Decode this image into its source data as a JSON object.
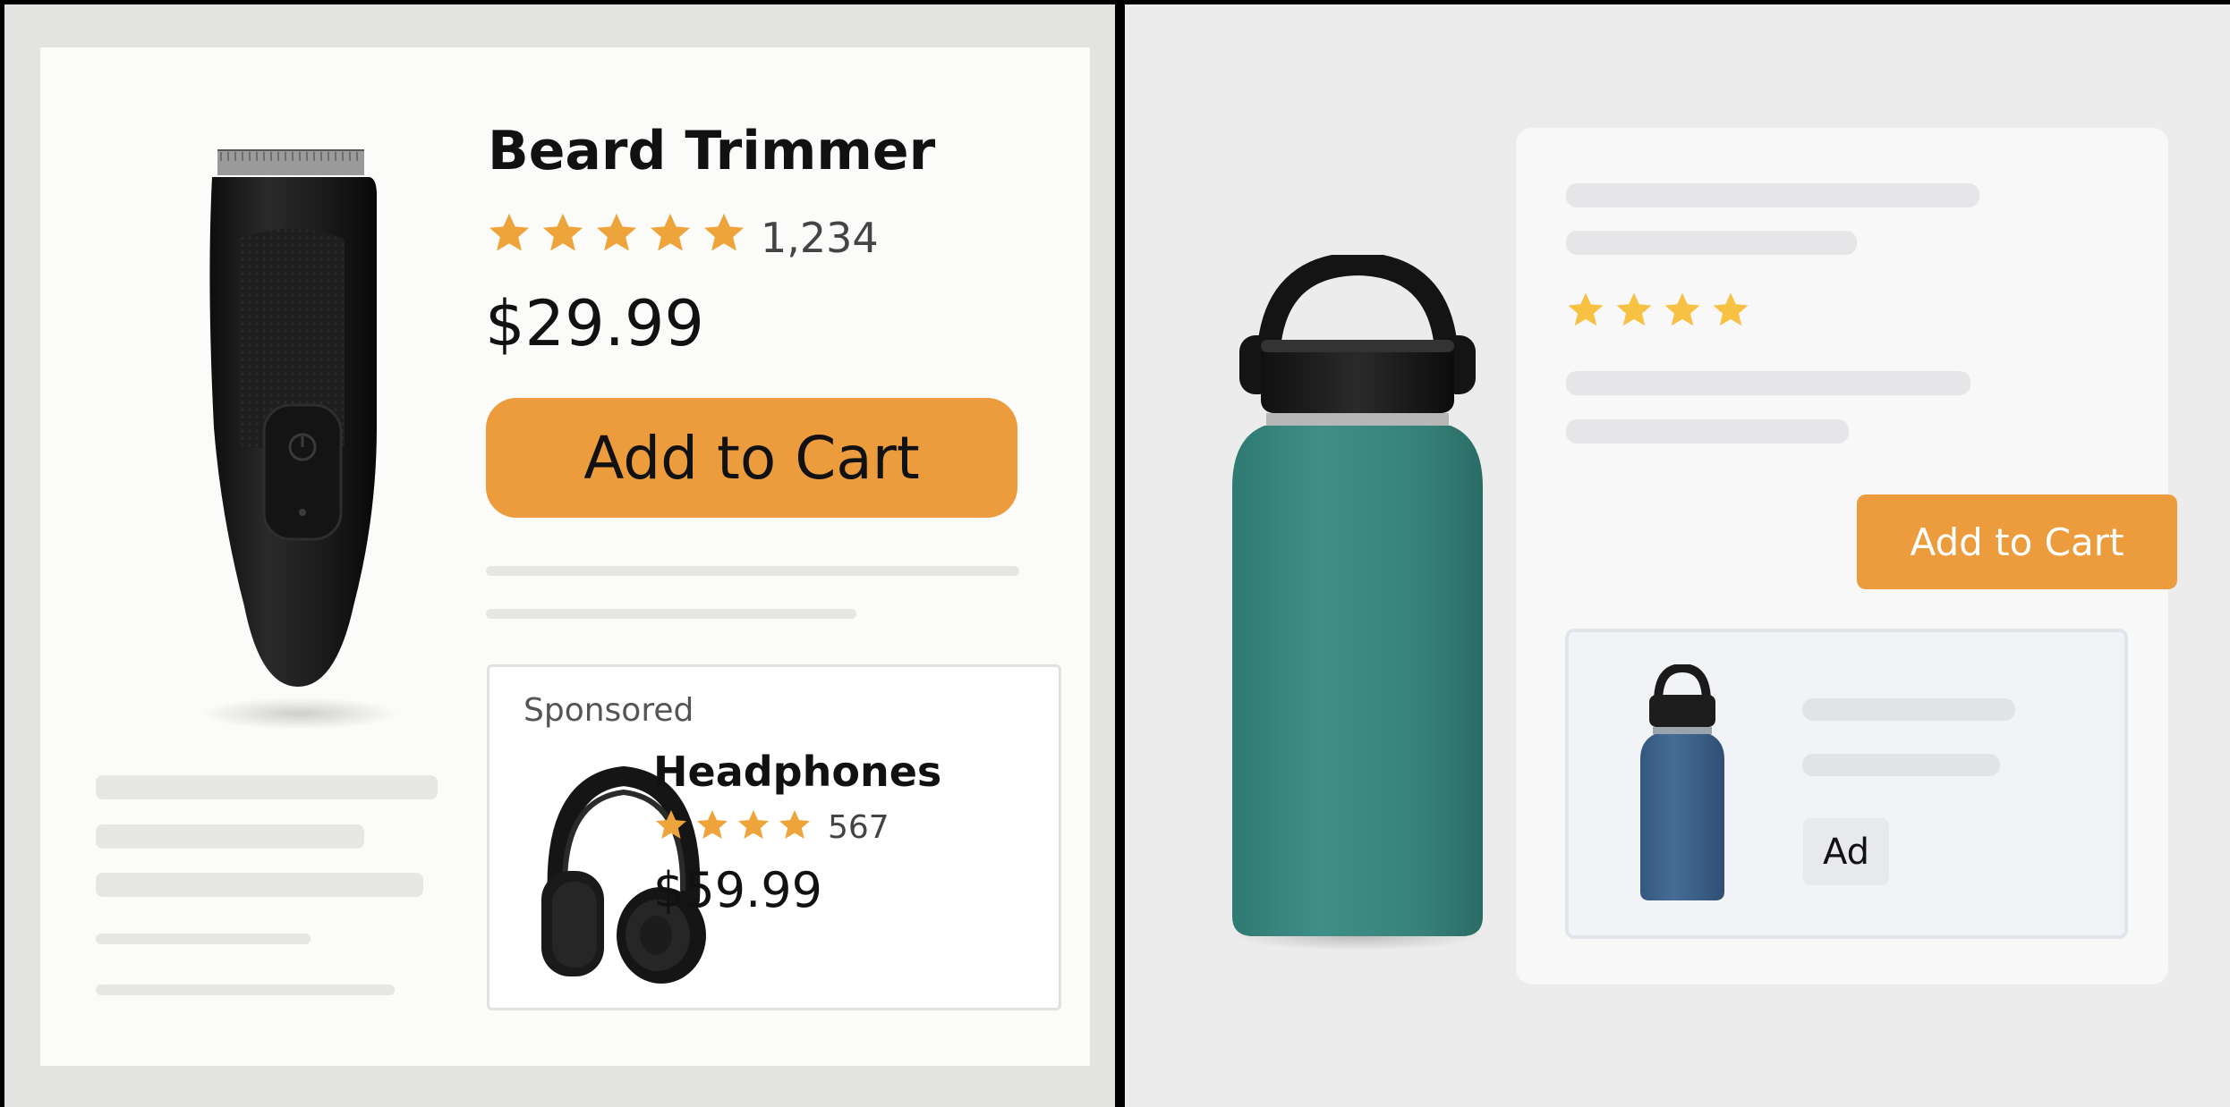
{
  "left": {
    "product": {
      "title": "Beard Trimmer",
      "rating_count": "1,234",
      "price": "$29.99",
      "add_to_cart_label": "Add to Cart",
      "image_icon": "beard-trimmer-image"
    },
    "sponsored": {
      "label": "Sponsored",
      "title": "Headphones",
      "rating_count": "567",
      "price": "$59.99",
      "image_icon": "headphones-image"
    }
  },
  "right": {
    "product": {
      "add_to_cart_label": "Add to Cart",
      "image_icon": "water-bottle-image"
    },
    "ad": {
      "badge": "Ad",
      "image_icon": "water-bottle-image"
    }
  },
  "colors": {
    "accent_orange": "#ec9c3c",
    "star_orange": "#eda43b",
    "star_yellow": "#f7c244",
    "placeholder_gray": "#e6e6e4"
  }
}
